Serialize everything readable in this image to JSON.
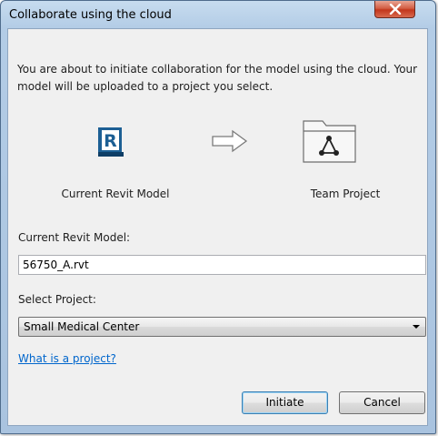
{
  "window": {
    "title": "Collaborate using the cloud"
  },
  "intro_text": "You are about to initiate collaboration for the model using the cloud. Your model will be uploaded to a project you select.",
  "illustration": {
    "left_icon": "revit-icon",
    "left_icon_letter": "R",
    "middle_icon": "arrow-right-icon",
    "right_icon": "folder-network-icon",
    "left_caption": "Current Revit Model",
    "right_caption": "Team Project"
  },
  "model_field": {
    "label": "Current Revit Model:",
    "value": "56750_A.rvt"
  },
  "project_field": {
    "label": "Select Project:",
    "selected": "Small Medical Center"
  },
  "help_link": "What is a project?",
  "buttons": {
    "initiate": "Initiate",
    "cancel": "Cancel"
  },
  "colors": {
    "revit_blue": "#1c5f94",
    "link": "#0066cc",
    "close_red": "#c2361c"
  }
}
